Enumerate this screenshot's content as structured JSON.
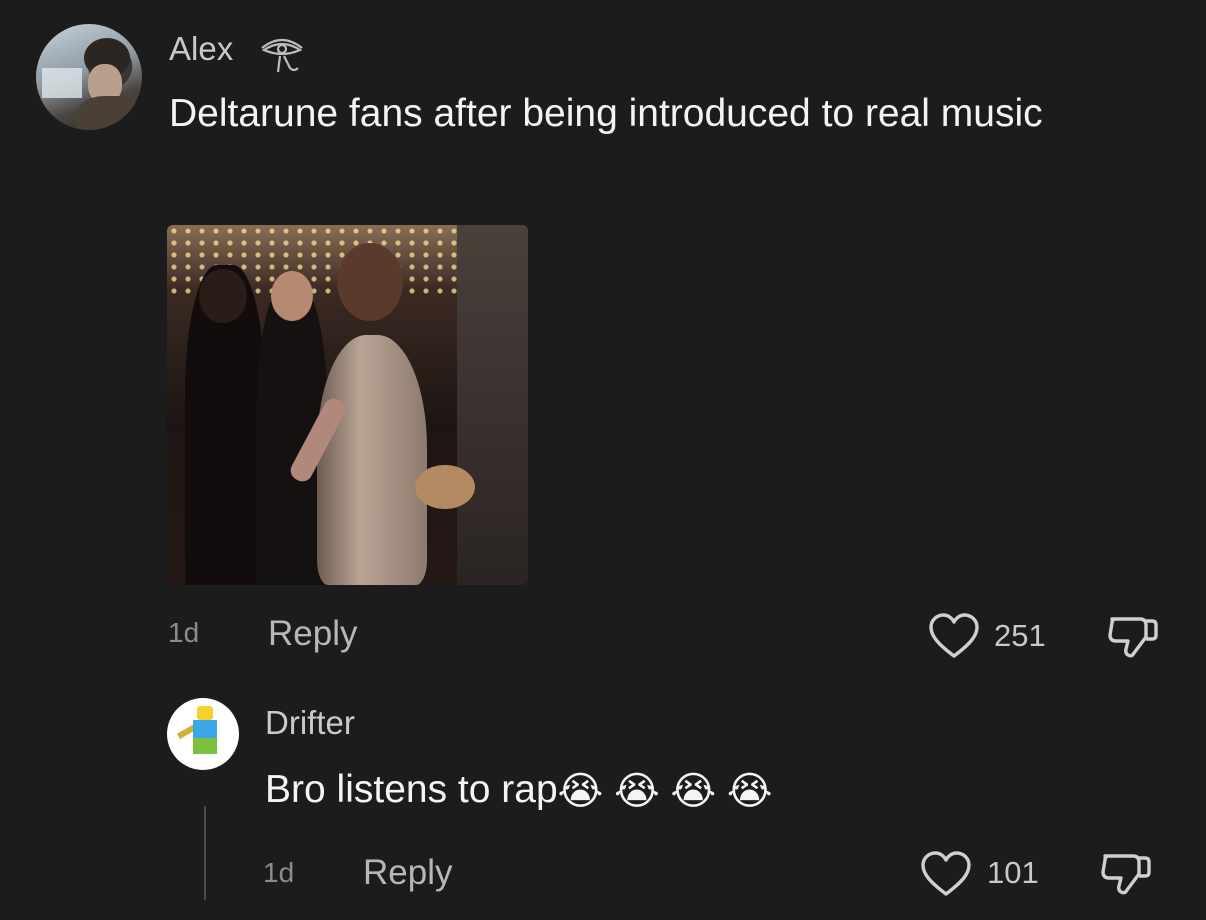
{
  "comment": {
    "username": "Alex",
    "badge_icon": "eye-of-horus-icon",
    "text": "Deltarune fans after being introduced to real music",
    "time": "1d",
    "reply_label": "Reply",
    "likes": "251"
  },
  "reply": {
    "username": "Drifter",
    "text": "Bro listens to rap",
    "emojis": [
      "😭",
      "😭",
      "😭",
      "😭"
    ],
    "time": "1d",
    "reply_label": "Reply",
    "likes": "101"
  },
  "icons": {
    "like": "heart-outline-icon",
    "dislike": "thumbs-down-icon"
  },
  "colors": {
    "background": "#1c1c1c",
    "username": "#c9c9c9",
    "text": "#f4f4f4",
    "meta": "#8c8c8c"
  }
}
